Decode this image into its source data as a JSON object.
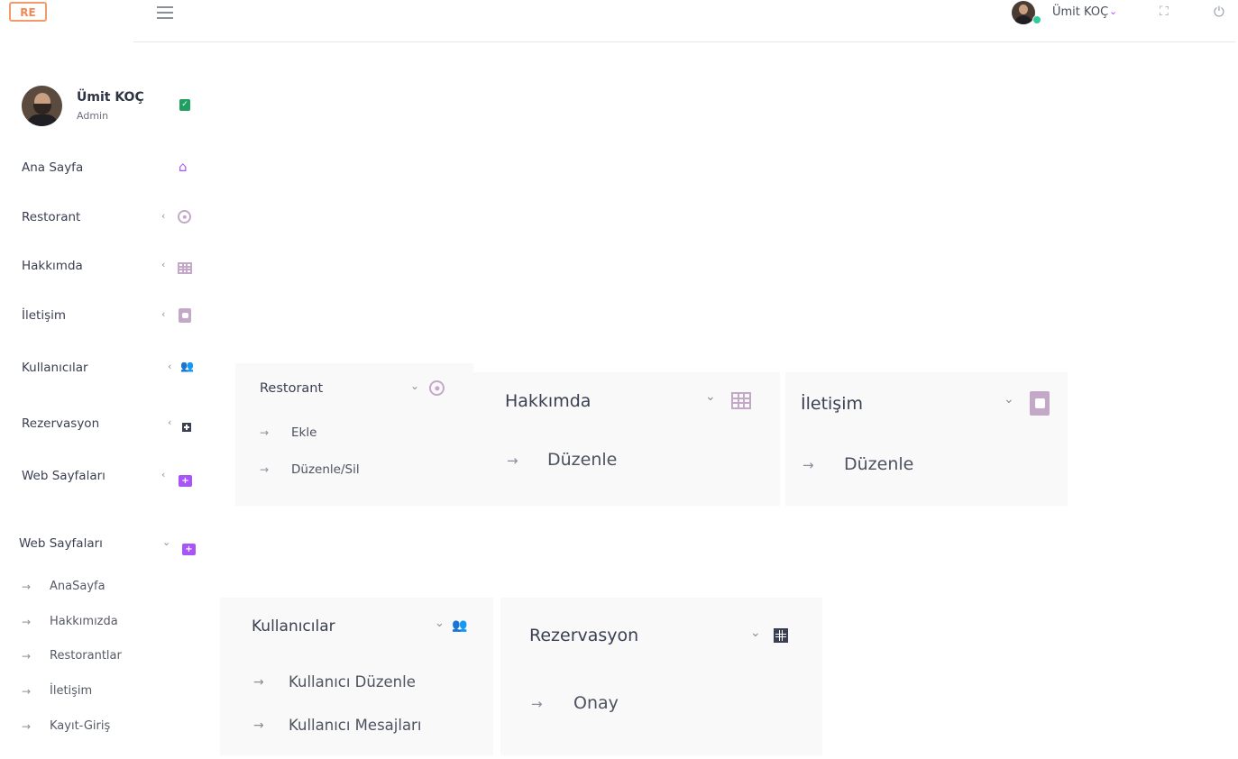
{
  "header": {
    "logo_text": "RE",
    "username": "Ümit KOÇ",
    "chevron": "⌄",
    "fullscreen_icon": "⛶",
    "power_icon": "⏻"
  },
  "profile": {
    "name": "Ümit KOÇ",
    "role": "Admin",
    "verified_mark": "✓"
  },
  "sidebar": {
    "items": [
      {
        "label": "Ana Sayfa"
      },
      {
        "label": "Restorant",
        "chevron": "‹"
      },
      {
        "label": "Hakkımda",
        "chevron": "‹"
      },
      {
        "label": "İletişim",
        "chevron": "‹"
      },
      {
        "label": "Kullanıcılar",
        "chevron": "‹"
      },
      {
        "label": "Rezervasyon",
        "chevron": "‹"
      },
      {
        "label": "Web Sayfaları",
        "chevron": "‹"
      }
    ],
    "web_pages_expanded": {
      "label": "Web Sayfaları",
      "chevron": "⌄",
      "subitems": [
        {
          "label": "AnaSayfa"
        },
        {
          "label": "Hakkımızda"
        },
        {
          "label": "Restorantlar"
        },
        {
          "label": "İletişim"
        },
        {
          "label": "Kayıt-Giriş"
        }
      ]
    }
  },
  "arrow": "→",
  "cards": {
    "restorant": {
      "title": "Restorant",
      "chevron": "⌄",
      "links": [
        "Ekle",
        "Düzenle/Sil"
      ]
    },
    "hakkimda": {
      "title": "Hakkımda",
      "chevron": "⌄",
      "links": [
        "Düzenle"
      ]
    },
    "iletisim": {
      "title": "İletişim",
      "chevron": "⌄",
      "links": [
        "Düzenle"
      ]
    },
    "kullanicilar": {
      "title": "Kullanıcılar",
      "chevron": "⌄",
      "links": [
        "Kullanıcı Düzenle",
        "Kullanıcı Mesajları"
      ]
    },
    "rezervasyon": {
      "title": "Rezervasyon",
      "chevron": "⌄",
      "links": [
        "Onay"
      ]
    }
  },
  "colors": {
    "accent": "#a855f7",
    "icon_muted": "#c4a8c7",
    "verified": "#1fa060",
    "online": "#2ecc9a",
    "card_bg": "#f9f9fa"
  }
}
